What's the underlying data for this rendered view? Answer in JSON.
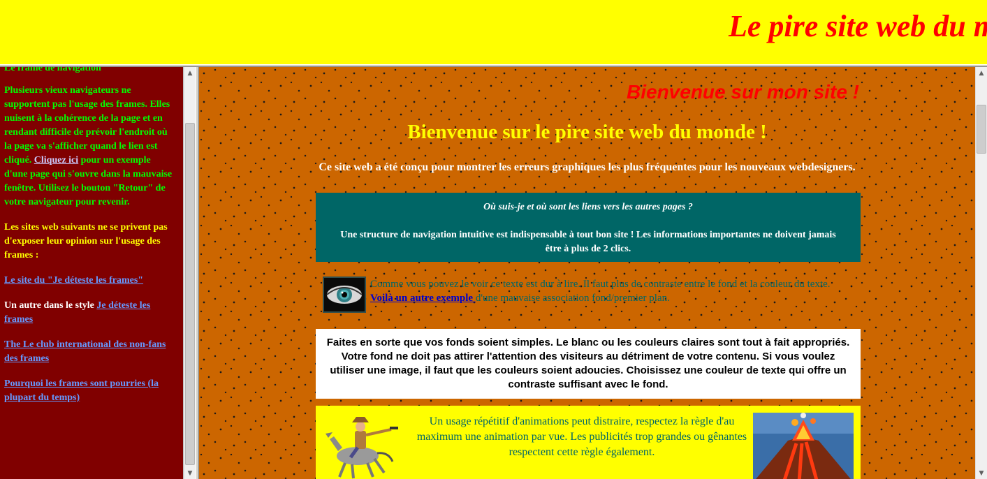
{
  "banner": {
    "title": "Le pire site web du monde"
  },
  "sidebar": {
    "cut_top": "Le frame de navigation",
    "para1_text": "Plusieurs vieux navigateurs ne supportent pas l'usage des frames. Elles nuisent à la cohérence de la page et en rendant difficile de prévoir l'endroit où la page va s'afficher quand le lien est cliqué.",
    "para1_link": "Cliquez ici",
    "para1_tail": " pour un exemple d'une page qui s'ouvre dans la mauvaise fenêtre. Utilisez le bouton \"Retour\" de votre navigateur pour revenir.",
    "para2": "Les sites web suivants ne se privent pas d'exposer leur opinion sur l'usage des frames :",
    "link1": "Le site du \"Je déteste les frames\"",
    "para3_text": "Un autre dans le style ",
    "link2": "Je déteste les frames",
    "link3": "The Le club international des non-fans des frames",
    "link4": "Pourquoi les frames sont pourries (la plupart du temps)"
  },
  "main": {
    "welcome": "Bienvenue sur mon site !",
    "heading": "Bienvenue sur le pire site web du monde !",
    "intro": "Ce site web a été conçu pour montrer les erreurs graphiques les plus fréquentes pour les nouveaux webdesigners.",
    "nav_question": "Où suis-je et où sont les liens vers les autres pages ?",
    "nav_text": "Une structure de navigation intuitive est indispensable à tout bon site ! Les informations importantes ne doivent jamais être à plus de 2 clics.",
    "eye_text_before": "Comme vous pouvez le voir ce texte est dur à lire. Il faut plus de contraste entre le fond et la couleur du texte.",
    "eye_link": " Voilà un autre exemple ",
    "eye_text_after": "d'une mauvaise association fond/premier plan.",
    "white_box": "Faites en sorte que vos fonds soient simples. Le blanc ou les couleurs claires sont tout à fait appropriés. Votre fond ne doit pas attirer l'attention des visiteurs au détriment de votre contenu. Si vous voulez utiliser une image, il faut que les couleurs soient adoucies. Choisissez une couleur de texte qui offre un contraste suffisant avec le fond.",
    "anim_text": "Un usage répétitif d'animations peut distraire, respectez la règle d'au maximum une animation par vue. Les publicités trop grandes ou gênantes respectent cette règle également."
  },
  "colors": {
    "banner_bg": "#ffff00",
    "banner_text": "#ff0000",
    "sidebar_bg": "#800000",
    "main_bg": "#cc6600",
    "nav_box_bg": "#006666"
  },
  "icons": [
    "eye-image",
    "cowboy-horse-image",
    "volcano-image",
    "scroll-up-arrow-icon",
    "scroll-down-arrow-icon"
  ]
}
